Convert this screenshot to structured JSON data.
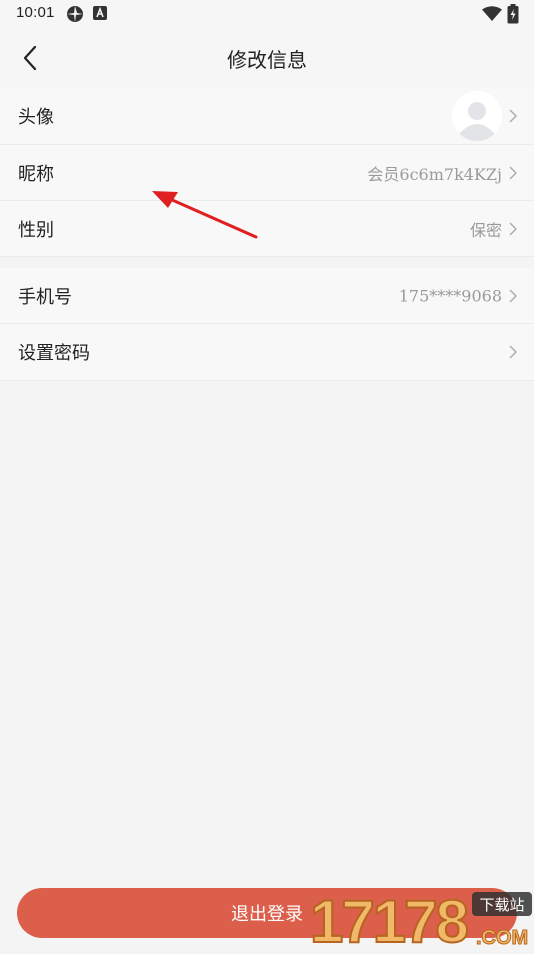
{
  "status_bar": {
    "time": "10:01"
  },
  "nav": {
    "title": "修改信息"
  },
  "profile_group": [
    {
      "label": "头像",
      "value": ""
    },
    {
      "label": "昵称",
      "value": "会员6c6m7k4KZj"
    },
    {
      "label": "性别",
      "value": "保密"
    }
  ],
  "account_group": [
    {
      "label": "手机号",
      "value": "175****9068"
    },
    {
      "label": "设置密码",
      "value": ""
    }
  ],
  "logout": {
    "label": "退出登录"
  },
  "watermark": {
    "text": "17178",
    "suffix": ".COM",
    "badge": "下载站"
  },
  "colors": {
    "accent": "#dc5f4b",
    "annotation": "#e02020"
  }
}
